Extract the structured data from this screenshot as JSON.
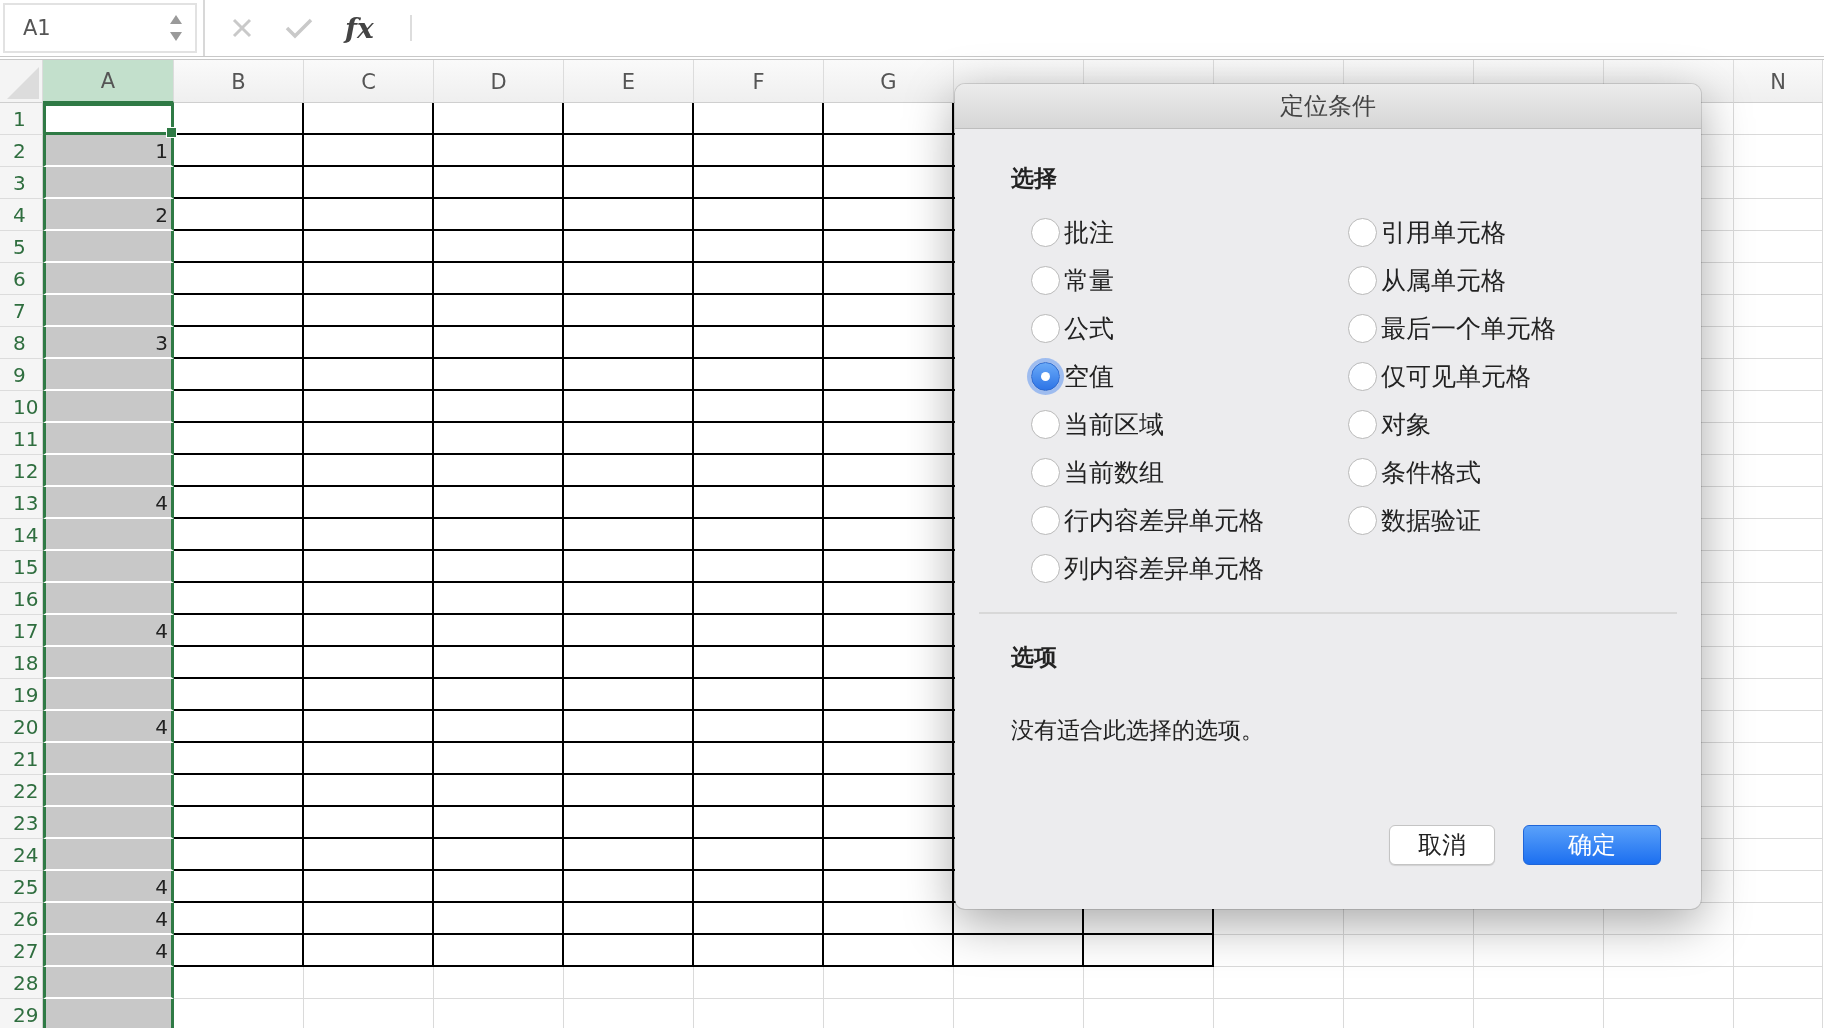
{
  "formula_bar": {
    "name_box": "A1",
    "function_label": "fx"
  },
  "columns": [
    {
      "label": "A",
      "selected": true
    },
    {
      "label": "B",
      "selected": false
    },
    {
      "label": "C",
      "selected": false
    },
    {
      "label": "D",
      "selected": false
    },
    {
      "label": "E",
      "selected": false
    },
    {
      "label": "F",
      "selected": false
    },
    {
      "label": "G",
      "selected": false
    },
    {
      "selected": false
    },
    {
      "selected": false
    },
    {
      "selected": false
    },
    {
      "selected": false
    },
    {
      "selected": false
    },
    {
      "selected": false
    },
    {
      "label": "N",
      "selected": false
    }
  ],
  "rows": [
    {
      "number": "1",
      "active": true,
      "selected": false,
      "bordered": true
    },
    {
      "number": "2",
      "value": "1",
      "active": false,
      "selected": true,
      "bordered": true
    },
    {
      "number": "3",
      "active": false,
      "selected": true,
      "bordered": true
    },
    {
      "number": "4",
      "value": "2",
      "active": false,
      "selected": true,
      "bordered": true
    },
    {
      "number": "5",
      "active": false,
      "selected": true,
      "bordered": true
    },
    {
      "number": "6",
      "active": false,
      "selected": true,
      "bordered": true
    },
    {
      "number": "7",
      "active": false,
      "selected": true,
      "bordered": true
    },
    {
      "number": "8",
      "value": "3",
      "active": false,
      "selected": true,
      "bordered": true
    },
    {
      "number": "9",
      "active": false,
      "selected": true,
      "bordered": true
    },
    {
      "number": "10",
      "active": false,
      "selected": true,
      "bordered": true
    },
    {
      "number": "11",
      "active": false,
      "selected": true,
      "bordered": true
    },
    {
      "number": "12",
      "active": false,
      "selected": true,
      "bordered": true
    },
    {
      "number": "13",
      "value": "4",
      "active": false,
      "selected": true,
      "bordered": true
    },
    {
      "number": "14",
      "active": false,
      "selected": true,
      "bordered": true
    },
    {
      "number": "15",
      "active": false,
      "selected": true,
      "bordered": true
    },
    {
      "number": "16",
      "active": false,
      "selected": true,
      "bordered": true
    },
    {
      "number": "17",
      "value": "4",
      "active": false,
      "selected": true,
      "bordered": true
    },
    {
      "number": "18",
      "active": false,
      "selected": true,
      "bordered": true
    },
    {
      "number": "19",
      "active": false,
      "selected": true,
      "bordered": true
    },
    {
      "number": "20",
      "value": "4",
      "active": false,
      "selected": true,
      "bordered": true
    },
    {
      "number": "21",
      "active": false,
      "selected": true,
      "bordered": true
    },
    {
      "number": "22",
      "active": false,
      "selected": true,
      "bordered": true
    },
    {
      "number": "23",
      "active": false,
      "selected": true,
      "bordered": true
    },
    {
      "number": "24",
      "active": false,
      "selected": true,
      "bordered": true
    },
    {
      "number": "25",
      "value": "4",
      "active": false,
      "selected": true,
      "bordered": true
    },
    {
      "number": "26",
      "value": "4",
      "active": false,
      "selected": true,
      "bordered": true
    },
    {
      "number": "27",
      "value": "4",
      "active": false,
      "selected": true,
      "bordered": true
    },
    {
      "number": "28",
      "active": false,
      "selected": true,
      "bordered": false
    },
    {
      "number": "29",
      "active": false,
      "selected": true,
      "bordered": false
    }
  ],
  "dialog": {
    "title": "定位条件",
    "section_title": "选择",
    "options": [
      {
        "label": "批注",
        "selected": false
      },
      {
        "label": "常量",
        "selected": false
      },
      {
        "label": "公式",
        "selected": false
      },
      {
        "label": "空值",
        "selected": true
      },
      {
        "label": "当前区域",
        "selected": false
      },
      {
        "label": "当前数组",
        "selected": false
      },
      {
        "label": "行内容差异单元格",
        "selected": false
      },
      {
        "label": "列内容差异单元格",
        "selected": false
      },
      {
        "label": "引用单元格",
        "selected": false
      },
      {
        "label": "从属单元格",
        "selected": false
      },
      {
        "label": "最后一个单元格",
        "selected": false
      },
      {
        "label": "仅可见单元格",
        "selected": false
      },
      {
        "label": "对象",
        "selected": false
      },
      {
        "label": "条件格式",
        "selected": false
      },
      {
        "label": "数据验证",
        "selected": false
      }
    ],
    "options_title": "选项",
    "options_message": "没有适合此选择的选项。",
    "buttons": [
      {
        "label": "取消",
        "kind": "secondary"
      },
      {
        "label": "确定",
        "kind": "default"
      }
    ]
  }
}
